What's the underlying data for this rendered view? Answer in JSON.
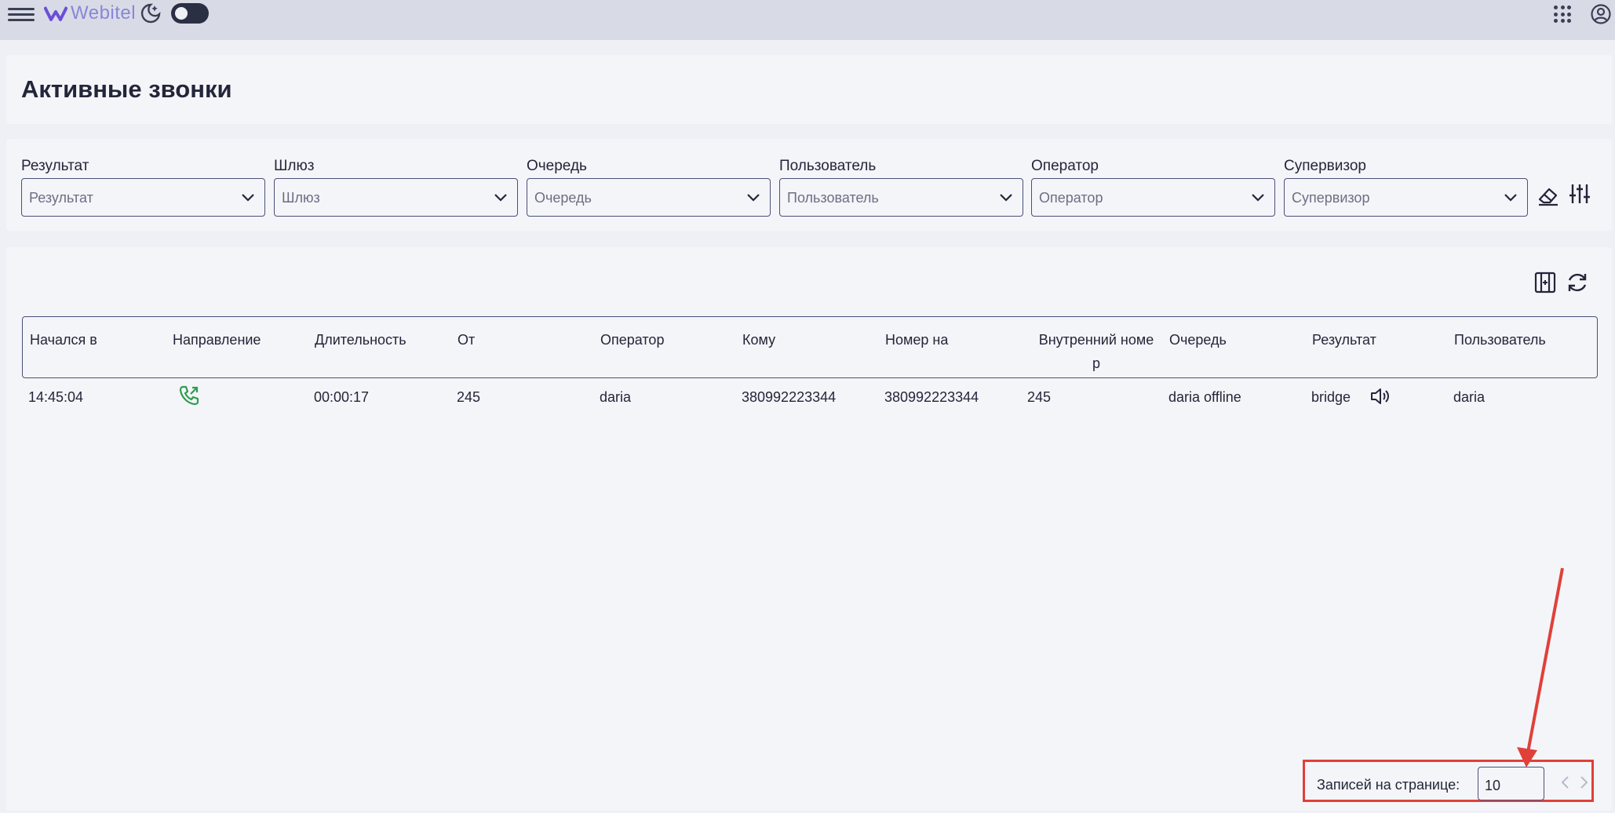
{
  "header": {
    "logo_text": "Webitel",
    "theme_toggle": "off"
  },
  "page": {
    "title": "Активные звонки"
  },
  "filters": [
    {
      "label": "Результат",
      "placeholder": "Результат"
    },
    {
      "label": "Шлюз",
      "placeholder": "Шлюз"
    },
    {
      "label": "Очередь",
      "placeholder": "Очередь"
    },
    {
      "label": "Пользователь",
      "placeholder": "Пользователь"
    },
    {
      "label": "Оператор",
      "placeholder": "Оператор"
    },
    {
      "label": "Супервизор",
      "placeholder": "Супервизор"
    }
  ],
  "table": {
    "columns": [
      "Начался в",
      "Направление",
      "Длительность",
      "От",
      "Оператор",
      "Кому",
      "Номер на",
      "Внутренний номе\nр",
      "Очередь",
      "Результат",
      "Пользователь"
    ],
    "rows": [
      {
        "started": "14:45:04",
        "direction_icon": "outbound-call-icon",
        "duration": "00:00:17",
        "from": "245",
        "operator": "daria",
        "to": "380992223344",
        "number_on": "380992223344",
        "extension": "245",
        "queue": "daria offline",
        "result": "bridge",
        "user": "daria"
      }
    ]
  },
  "pagination": {
    "per_page_label": "Записей на странице:",
    "per_page_value": "10"
  },
  "colors": {
    "accent": "#4a5078",
    "call_icon": "#2e9e4f",
    "annotation": "#e0403a"
  }
}
